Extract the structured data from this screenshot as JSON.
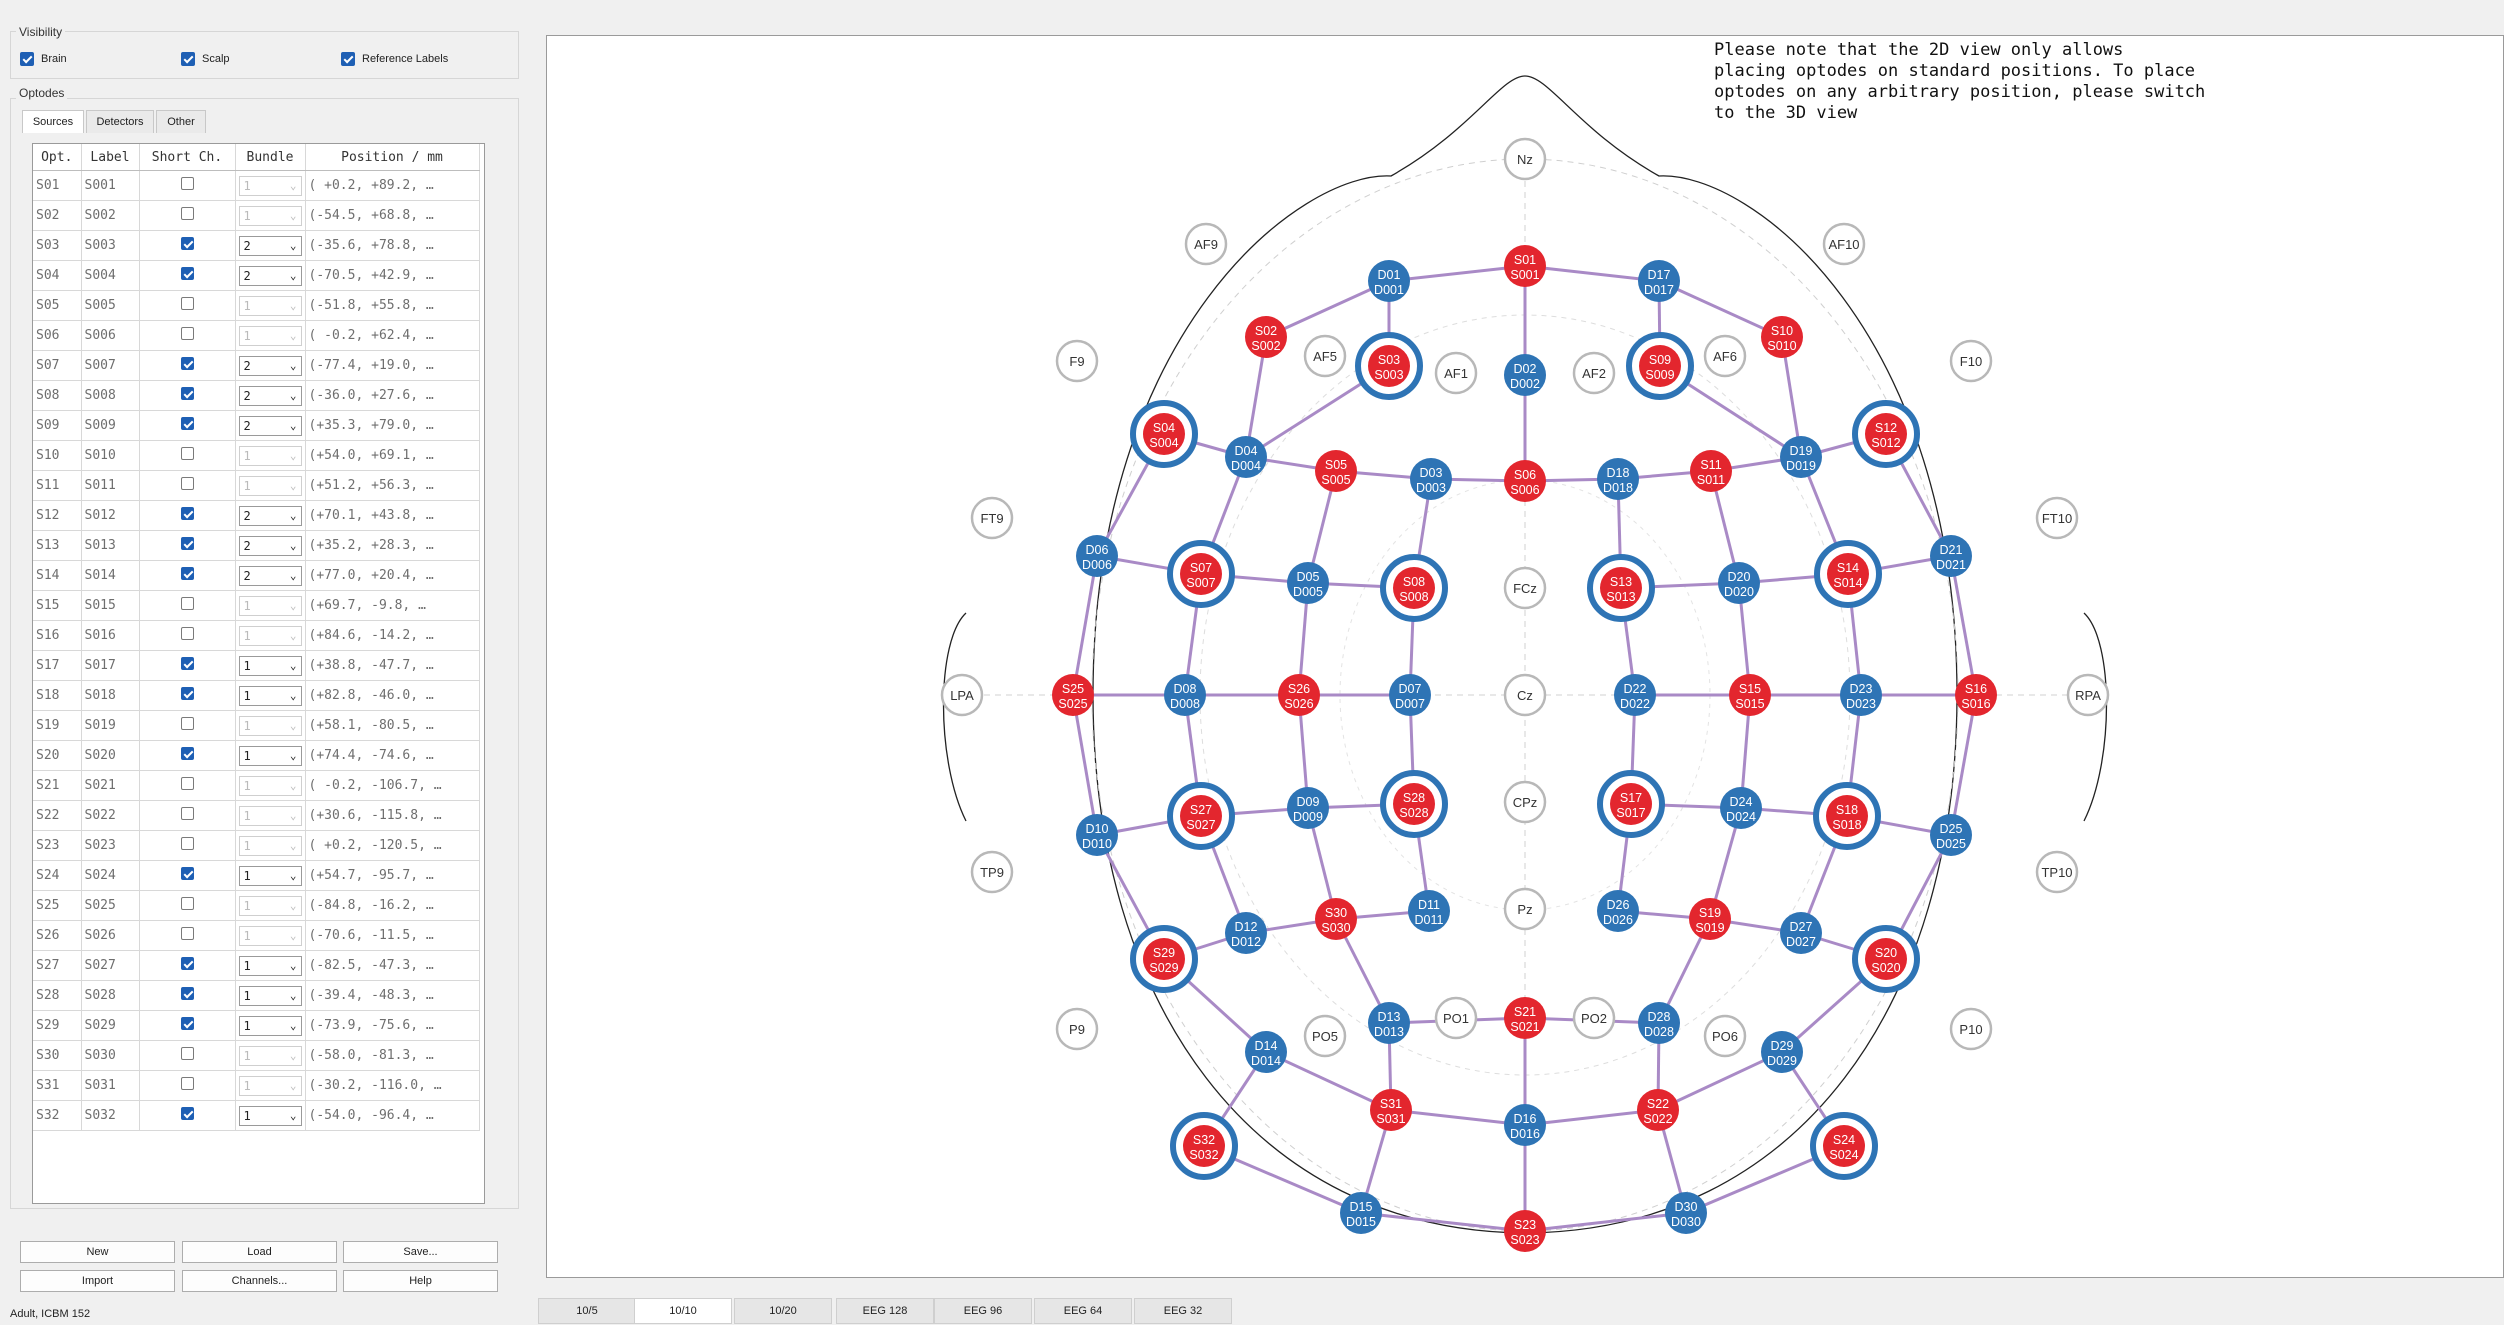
{
  "visibility": {
    "title": "Visibility",
    "brain": "Brain",
    "scalp": "Scalp",
    "reference": "Reference Labels"
  },
  "optodes": {
    "title": "Optodes",
    "tabs": [
      "Sources",
      "Detectors",
      "Other"
    ]
  },
  "table": {
    "headers": [
      "Opt.",
      "Label",
      "Short Ch.",
      "Bundle",
      "Position / mm"
    ],
    "rows": [
      {
        "opt": "S01",
        "label": "S001",
        "short": false,
        "bundle": "1",
        "pos": "( +0.2, +89.2,  …"
      },
      {
        "opt": "S02",
        "label": "S002",
        "short": false,
        "bundle": "1",
        "pos": "(-54.5, +68.8,  …"
      },
      {
        "opt": "S03",
        "label": "S003",
        "short": true,
        "bundle": "2",
        "pos": "(-35.6, +78.8,  …"
      },
      {
        "opt": "S04",
        "label": "S004",
        "short": true,
        "bundle": "2",
        "pos": "(-70.5, +42.9,  …"
      },
      {
        "opt": "S05",
        "label": "S005",
        "short": false,
        "bundle": "1",
        "pos": "(-51.8, +55.8,  …"
      },
      {
        "opt": "S06",
        "label": "S006",
        "short": false,
        "bundle": "1",
        "pos": "( -0.2, +62.4,  …"
      },
      {
        "opt": "S07",
        "label": "S007",
        "short": true,
        "bundle": "2",
        "pos": "(-77.4, +19.0,  …"
      },
      {
        "opt": "S08",
        "label": "S008",
        "short": true,
        "bundle": "2",
        "pos": "(-36.0, +27.6,  …"
      },
      {
        "opt": "S09",
        "label": "S009",
        "short": true,
        "bundle": "2",
        "pos": "(+35.3, +79.0,  …"
      },
      {
        "opt": "S10",
        "label": "S010",
        "short": false,
        "bundle": "1",
        "pos": "(+54.0, +69.1,  …"
      },
      {
        "opt": "S11",
        "label": "S011",
        "short": false,
        "bundle": "1",
        "pos": "(+51.2, +56.3,  …"
      },
      {
        "opt": "S12",
        "label": "S012",
        "short": true,
        "bundle": "2",
        "pos": "(+70.1, +43.8,  …"
      },
      {
        "opt": "S13",
        "label": "S013",
        "short": true,
        "bundle": "2",
        "pos": "(+35.2, +28.3,  …"
      },
      {
        "opt": "S14",
        "label": "S014",
        "short": true,
        "bundle": "2",
        "pos": "(+77.0, +20.4,  …"
      },
      {
        "opt": "S15",
        "label": "S015",
        "short": false,
        "bundle": "1",
        "pos": "(+69.7,  -9.8,  …"
      },
      {
        "opt": "S16",
        "label": "S016",
        "short": false,
        "bundle": "1",
        "pos": "(+84.6, -14.2,  …"
      },
      {
        "opt": "S17",
        "label": "S017",
        "short": true,
        "bundle": "1",
        "pos": "(+38.8, -47.7,  …"
      },
      {
        "opt": "S18",
        "label": "S018",
        "short": true,
        "bundle": "1",
        "pos": "(+82.8, -46.0,  …"
      },
      {
        "opt": "S19",
        "label": "S019",
        "short": false,
        "bundle": "1",
        "pos": "(+58.1, -80.5,  …"
      },
      {
        "opt": "S20",
        "label": "S020",
        "short": true,
        "bundle": "1",
        "pos": "(+74.4, -74.6,  …"
      },
      {
        "opt": "S21",
        "label": "S021",
        "short": false,
        "bundle": "1",
        "pos": "( -0.2, -106.7,  …"
      },
      {
        "opt": "S22",
        "label": "S022",
        "short": false,
        "bundle": "1",
        "pos": "(+30.6, -115.8,  …"
      },
      {
        "opt": "S23",
        "label": "S023",
        "short": false,
        "bundle": "1",
        "pos": "( +0.2, -120.5,  …"
      },
      {
        "opt": "S24",
        "label": "S024",
        "short": true,
        "bundle": "1",
        "pos": "(+54.7, -95.7,  …"
      },
      {
        "opt": "S25",
        "label": "S025",
        "short": false,
        "bundle": "1",
        "pos": "(-84.8, -16.2,  …"
      },
      {
        "opt": "S26",
        "label": "S026",
        "short": false,
        "bundle": "1",
        "pos": "(-70.6, -11.5,  …"
      },
      {
        "opt": "S27",
        "label": "S027",
        "short": true,
        "bundle": "1",
        "pos": "(-82.5, -47.3,  …"
      },
      {
        "opt": "S28",
        "label": "S028",
        "short": true,
        "bundle": "1",
        "pos": "(-39.4, -48.3,  …"
      },
      {
        "opt": "S29",
        "label": "S029",
        "short": true,
        "bundle": "1",
        "pos": "(-73.9, -75.6,  …"
      },
      {
        "opt": "S30",
        "label": "S030",
        "short": false,
        "bundle": "1",
        "pos": "(-58.0, -81.3,  …"
      },
      {
        "opt": "S31",
        "label": "S031",
        "short": false,
        "bundle": "1",
        "pos": "(-30.2, -116.0,  …"
      },
      {
        "opt": "S32",
        "label": "S032",
        "short": true,
        "bundle": "1",
        "pos": "(-54.0, -96.4,  …"
      }
    ]
  },
  "buttons": {
    "new": "New",
    "load": "Load",
    "save": "Save...",
    "import": "Import",
    "channels": "Channels...",
    "help": "Help"
  },
  "status": "Adult, ICBM 152",
  "note": [
    "Please note that the 2D view only allows",
    "placing optodes on standard positions. To place",
    "optodes on any arbitrary position, please switch",
    "to the 3D view"
  ],
  "view_tabs": [
    "10/5",
    "10/10",
    "10/20",
    "EEG 128",
    "EEG 96",
    "EEG 64",
    "EEG 32"
  ],
  "active_view_tab": "10/10",
  "colors": {
    "source": "#e3262e",
    "detector": "#2e74b5",
    "link": "#a98ac6",
    "ref_border": "#b8b8b8"
  },
  "montage": {
    "refs": [
      "Nz",
      "AF9",
      "AF10",
      "F9",
      "F10",
      "AF5",
      "AF1",
      "AF2",
      "AF6",
      "FT9",
      "FT10",
      "LPA",
      "RPA",
      "FCz",
      "Cz",
      "CPz",
      "Pz",
      "TP9",
      "TP10",
      "P9",
      "P10",
      "PO5",
      "PO1",
      "PO2",
      "PO6"
    ],
    "sources": [
      [
        "S01",
        "S001",
        false
      ],
      [
        "S02",
        "S002",
        false
      ],
      [
        "S03",
        "S003",
        true
      ],
      [
        "S04",
        "S004",
        true
      ],
      [
        "S05",
        "S005",
        false
      ],
      [
        "S06",
        "S006",
        false
      ],
      [
        "S07",
        "S007",
        true
      ],
      [
        "S08",
        "S008",
        true
      ],
      [
        "S09",
        "S009",
        true
      ],
      [
        "S10",
        "S010",
        false
      ],
      [
        "S11",
        "S011",
        false
      ],
      [
        "S12",
        "S012",
        true
      ],
      [
        "S13",
        "S013",
        true
      ],
      [
        "S14",
        "S014",
        true
      ],
      [
        "S15",
        "S015",
        false
      ],
      [
        "S16",
        "S016",
        false
      ],
      [
        "S17",
        "S017",
        true
      ],
      [
        "S18",
        "S018",
        true
      ],
      [
        "S19",
        "S019",
        false
      ],
      [
        "S20",
        "S020",
        true
      ],
      [
        "S21",
        "S021",
        false
      ],
      [
        "S22",
        "S022",
        false
      ],
      [
        "S23",
        "S023",
        false
      ],
      [
        "S24",
        "S024",
        true
      ],
      [
        "S25",
        "S025",
        false
      ],
      [
        "S26",
        "S026",
        false
      ],
      [
        "S27",
        "S027",
        true
      ],
      [
        "S28",
        "S028",
        true
      ],
      [
        "S29",
        "S029",
        true
      ],
      [
        "S30",
        "S030",
        false
      ],
      [
        "S31",
        "S031",
        false
      ],
      [
        "S32",
        "S032",
        true
      ]
    ],
    "detectors": [
      [
        "D01",
        "D001"
      ],
      [
        "D02",
        "D002"
      ],
      [
        "D03",
        "D003"
      ],
      [
        "D04",
        "D004"
      ],
      [
        "D05",
        "D005"
      ],
      [
        "D06",
        "D006"
      ],
      [
        "D07",
        "D007"
      ],
      [
        "D08",
        "D008"
      ],
      [
        "D09",
        "D009"
      ],
      [
        "D10",
        "D010"
      ],
      [
        "D11",
        "D011"
      ],
      [
        "D12",
        "D012"
      ],
      [
        "D13",
        "D013"
      ],
      [
        "D14",
        "D014"
      ],
      [
        "D15",
        "D015"
      ],
      [
        "D16",
        "D016"
      ],
      [
        "D17",
        "D017"
      ],
      [
        "D18",
        "D018"
      ],
      [
        "D19",
        "D019"
      ],
      [
        "D20",
        "D020"
      ],
      [
        "D21",
        "D021"
      ],
      [
        "D22",
        "D022"
      ],
      [
        "D23",
        "D023"
      ],
      [
        "D24",
        "D024"
      ],
      [
        "D25",
        "D025"
      ],
      [
        "D26",
        "D026"
      ],
      [
        "D27",
        "D027"
      ],
      [
        "D28",
        "D028"
      ],
      [
        "D29",
        "D029"
      ],
      [
        "D30",
        "D030"
      ]
    ],
    "channels": [
      [
        "S01",
        "D01"
      ],
      [
        "S01",
        "D17"
      ],
      [
        "S01",
        "D02"
      ],
      [
        "S02",
        "D01"
      ],
      [
        "S02",
        "D04"
      ],
      [
        "S03",
        "D01"
      ],
      [
        "S03",
        "D04"
      ],
      [
        "S04",
        "D04"
      ],
      [
        "S04",
        "D06"
      ],
      [
        "S05",
        "D04"
      ],
      [
        "S05",
        "D03"
      ],
      [
        "S05",
        "D05"
      ],
      [
        "S06",
        "D02"
      ],
      [
        "S06",
        "D03"
      ],
      [
        "S06",
        "D18"
      ],
      [
        "S07",
        "D04"
      ],
      [
        "S07",
        "D06"
      ],
      [
        "S07",
        "D05"
      ],
      [
        "S07",
        "D08"
      ],
      [
        "S08",
        "D03"
      ],
      [
        "S08",
        "D05"
      ],
      [
        "S08",
        "D07"
      ],
      [
        "S09",
        "D17"
      ],
      [
        "S09",
        "D19"
      ],
      [
        "S10",
        "D17"
      ],
      [
        "S10",
        "D19"
      ],
      [
        "S11",
        "D18"
      ],
      [
        "S11",
        "D19"
      ],
      [
        "S11",
        "D20"
      ],
      [
        "S12",
        "D19"
      ],
      [
        "S12",
        "D21"
      ],
      [
        "S13",
        "D18"
      ],
      [
        "S13",
        "D20"
      ],
      [
        "S13",
        "D22"
      ],
      [
        "S14",
        "D19"
      ],
      [
        "S14",
        "D20"
      ],
      [
        "S14",
        "D21"
      ],
      [
        "S14",
        "D23"
      ],
      [
        "S15",
        "D22"
      ],
      [
        "S15",
        "D23"
      ],
      [
        "S15",
        "D20"
      ],
      [
        "S15",
        "D24"
      ],
      [
        "S16",
        "D23"
      ],
      [
        "S16",
        "D21"
      ],
      [
        "S16",
        "D25"
      ],
      [
        "S17",
        "D22"
      ],
      [
        "S17",
        "D24"
      ],
      [
        "S17",
        "D26"
      ],
      [
        "S18",
        "D23"
      ],
      [
        "S18",
        "D24"
      ],
      [
        "S18",
        "D25"
      ],
      [
        "S18",
        "D27"
      ],
      [
        "S19",
        "D24"
      ],
      [
        "S19",
        "D26"
      ],
      [
        "S19",
        "D27"
      ],
      [
        "S19",
        "D28"
      ],
      [
        "S20",
        "D25"
      ],
      [
        "S20",
        "D27"
      ],
      [
        "S20",
        "D29"
      ],
      [
        "S21",
        "D13"
      ],
      [
        "S21",
        "D28"
      ],
      [
        "S21",
        "D16"
      ],
      [
        "S22",
        "D16"
      ],
      [
        "S22",
        "D28"
      ],
      [
        "S22",
        "D29"
      ],
      [
        "S22",
        "D30"
      ],
      [
        "S23",
        "D15"
      ],
      [
        "S23",
        "D16"
      ],
      [
        "S23",
        "D30"
      ],
      [
        "S24",
        "D29"
      ],
      [
        "S24",
        "D30"
      ],
      [
        "S25",
        "D06"
      ],
      [
        "S25",
        "D08"
      ],
      [
        "S25",
        "D10"
      ],
      [
        "S26",
        "D08"
      ],
      [
        "S26",
        "D07"
      ],
      [
        "S26",
        "D05"
      ],
      [
        "S26",
        "D09"
      ],
      [
        "S27",
        "D08"
      ],
      [
        "S27",
        "D09"
      ],
      [
        "S27",
        "D10"
      ],
      [
        "S27",
        "D12"
      ],
      [
        "S28",
        "D07"
      ],
      [
        "S28",
        "D09"
      ],
      [
        "S28",
        "D11"
      ],
      [
        "S29",
        "D10"
      ],
      [
        "S29",
        "D12"
      ],
      [
        "S29",
        "D14"
      ],
      [
        "S30",
        "D09"
      ],
      [
        "S30",
        "D11"
      ],
      [
        "S30",
        "D12"
      ],
      [
        "S30",
        "D13"
      ],
      [
        "S31",
        "D13"
      ],
      [
        "S31",
        "D14"
      ],
      [
        "S31",
        "D15"
      ],
      [
        "S31",
        "D16"
      ],
      [
        "S32",
        "D14"
      ],
      [
        "S32",
        "D15"
      ]
    ]
  }
}
